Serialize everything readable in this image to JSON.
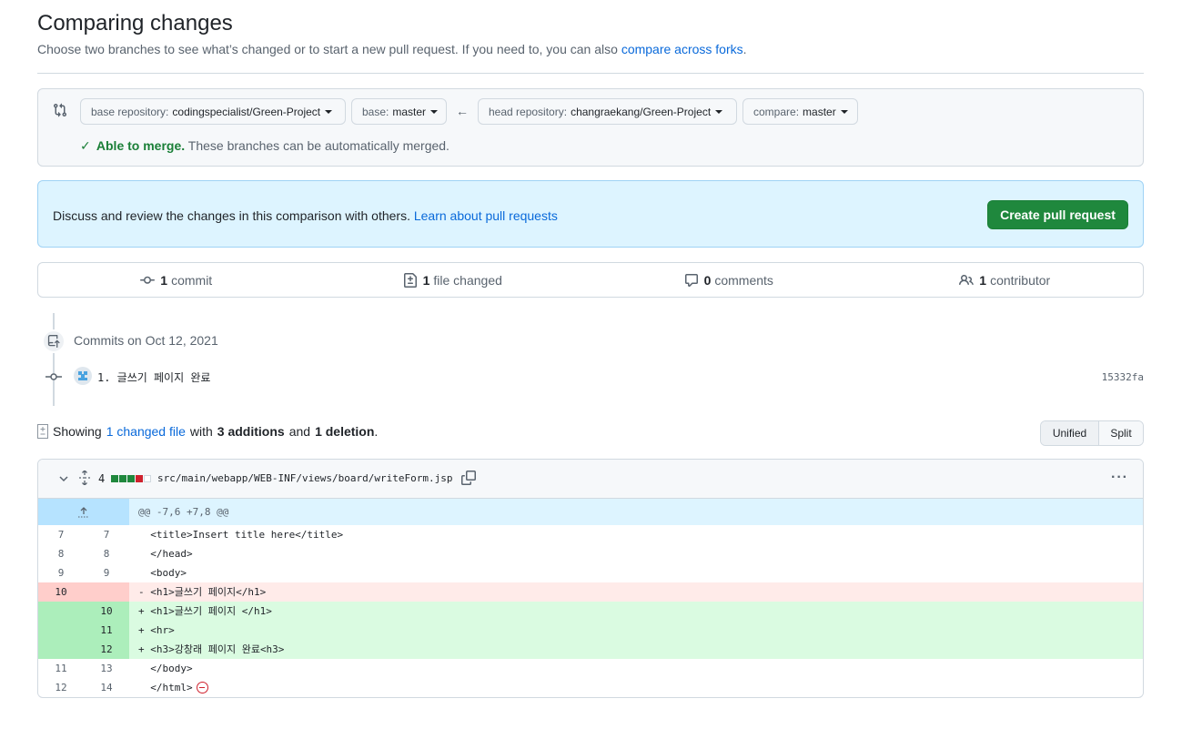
{
  "header": {
    "title": "Comparing changes",
    "subtitle_prefix": "Choose two branches to see what’s changed or to start a new pull request. If you need to, you can also",
    "subtitle_link": "compare across forks",
    "subtitle_suffix": "."
  },
  "range": {
    "base_repo_label": "base repository:",
    "base_repo_value": "codingspecialist/Green-Project",
    "base_label": "base:",
    "base_value": "master",
    "head_repo_label": "head repository:",
    "head_repo_value": "changraekang/Green-Project",
    "compare_label": "compare:",
    "compare_value": "master",
    "merge_ok": "Able to merge.",
    "merge_text": "These branches can be automatically merged."
  },
  "flash": {
    "text": "Discuss and review the changes in this comparison with others.",
    "link": "Learn about pull requests",
    "button": "Create pull request"
  },
  "summary": {
    "commits_count": "1",
    "commits_label": "commit",
    "files_count": "1",
    "files_label": "file changed",
    "comments_count": "0",
    "comments_label": "comments",
    "contributors_count": "1",
    "contributors_label": "contributor"
  },
  "commits": {
    "date_heading": "Commits on Oct 12, 2021",
    "items": [
      {
        "message": "1. 글쓰기 페이지 완료",
        "sha": "15332fa"
      }
    ]
  },
  "showing": {
    "prefix": "Showing",
    "files_link": "1 changed file",
    "with": "with",
    "additions": "3 additions",
    "and": "and",
    "deletions": "1 deletion",
    "end": "."
  },
  "view_toggle": {
    "unified": "Unified",
    "split": "Split"
  },
  "file": {
    "change_count": "4",
    "path": "src/main/webapp/WEB-INF/views/board/writeForm.jsp",
    "diffstat": [
      "add",
      "add",
      "add",
      "del",
      "neutral"
    ],
    "hunk_header": "@@ -7,6 +7,8 @@",
    "lines": [
      {
        "type": "ctx",
        "old": "7",
        "new": "7",
        "code": "  <title>Insert title here</title>"
      },
      {
        "type": "ctx",
        "old": "8",
        "new": "8",
        "code": "  </head>"
      },
      {
        "type": "ctx",
        "old": "9",
        "new": "9",
        "code": "  <body>"
      },
      {
        "type": "del",
        "old": "10",
        "new": "",
        "code": "- <h1>글쓰기 페이지</h1>"
      },
      {
        "type": "add",
        "old": "",
        "new": "10",
        "code": "+ <h1>글쓰기 페이지 </h1>"
      },
      {
        "type": "add",
        "old": "",
        "new": "11",
        "code": "+ <hr>"
      },
      {
        "type": "add",
        "old": "",
        "new": "12",
        "code": "+ <h3>강창래 페이지 완료<h3>"
      },
      {
        "type": "ctx",
        "old": "11",
        "new": "13",
        "code": "  </body>"
      },
      {
        "type": "ctx",
        "old": "12",
        "new": "14",
        "code": "  </html>"
      }
    ]
  },
  "colors": {
    "link": "#0969da",
    "success": "#1a7f37",
    "primary_button": "#1f883d",
    "diff_add": "#dafbe1",
    "diff_del": "#ffebe9",
    "hunk": "#ddf4ff"
  }
}
